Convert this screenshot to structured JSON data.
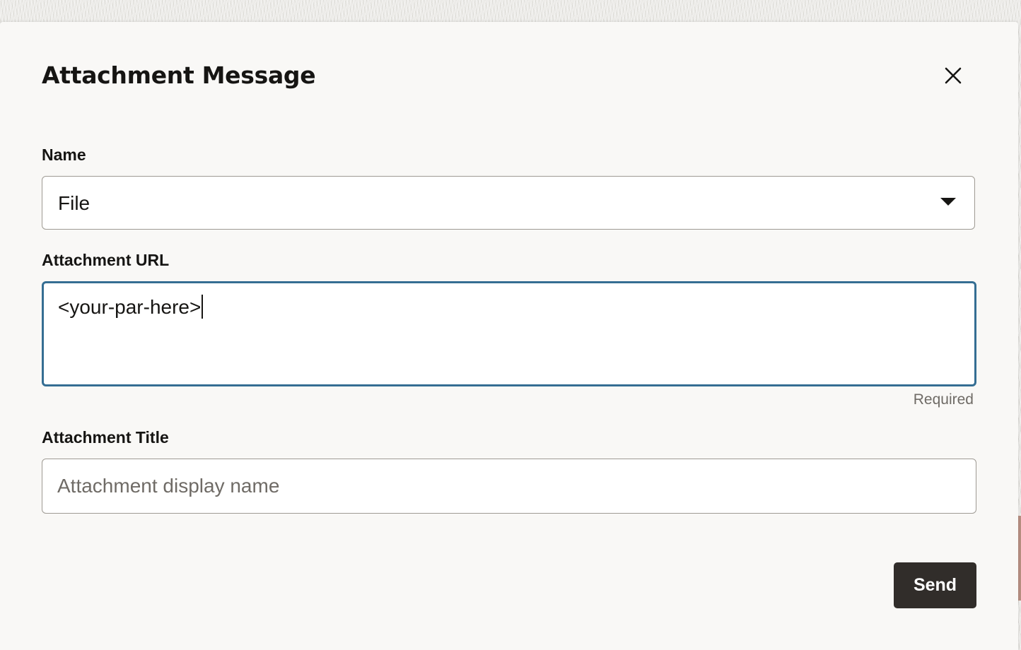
{
  "dialog": {
    "title": "Attachment Message",
    "close_icon": "close-icon"
  },
  "name_field": {
    "label": "Name",
    "value": "File",
    "caret_icon": "caret-down-icon"
  },
  "url_field": {
    "label": "Attachment URL",
    "value": "<your-par-here>",
    "helper": "Required"
  },
  "title_field": {
    "label": "Attachment Title",
    "value": "",
    "placeholder": "Attachment display name"
  },
  "actions": {
    "send_label": "Send"
  },
  "colors": {
    "primary_button": "#312d2a",
    "focus_border": "#356e93",
    "text": "#161513",
    "muted_text": "#6f6b66"
  }
}
